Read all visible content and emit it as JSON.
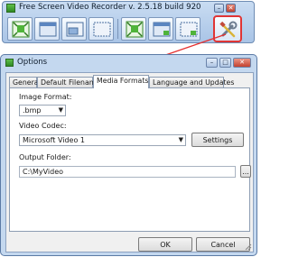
{
  "toolbar_window": {
    "title": "Free Screen Video Recorder  v. 2.5.18 build 920",
    "buttons": [
      {
        "name": "record-full-screen",
        "icon": "full-screen-capture-icon"
      },
      {
        "name": "record-window",
        "icon": "window-capture-icon"
      },
      {
        "name": "record-object",
        "icon": "object-capture-icon"
      },
      {
        "name": "record-region",
        "icon": "region-capture-icon"
      },
      {
        "name": "screenshot-full-screen",
        "icon": "full-screenshot-icon"
      },
      {
        "name": "screenshot-window",
        "icon": "window-screenshot-icon"
      },
      {
        "name": "screenshot-region",
        "icon": "region-screenshot-icon"
      },
      {
        "name": "settings",
        "icon": "tools-icon"
      }
    ],
    "highlight_color": "#e03535"
  },
  "dialog": {
    "title": "Options",
    "tabs": [
      "General",
      "Default Filename",
      "Media Formats",
      "Language and Updates"
    ],
    "active_tab": "Media Formats",
    "image_format_label": "Image Format:",
    "image_format_value": ".bmp",
    "video_codec_label": "Video Codec:",
    "video_codec_value": "Microsoft Video 1",
    "settings_button": "Settings",
    "output_folder_label": "Output Folder:",
    "output_folder_value": "C:\\MyVideo",
    "browse_button": "...",
    "ok_button": "OK",
    "cancel_button": "Cancel"
  }
}
